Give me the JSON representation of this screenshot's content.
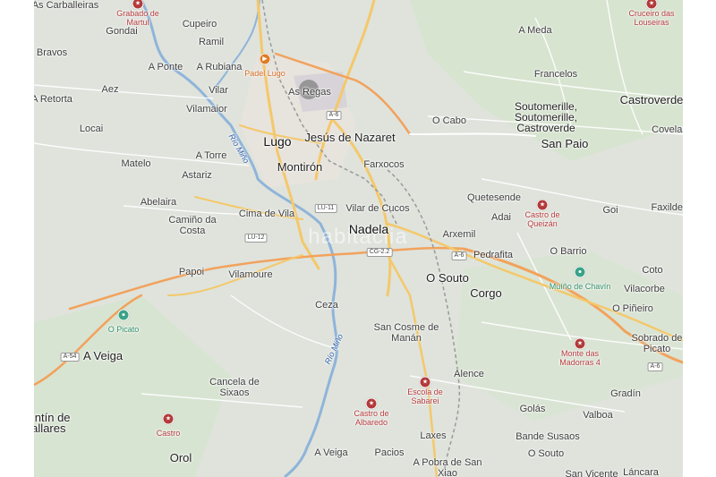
{
  "watermark": "habitaclia",
  "places": [
    {
      "name": "As Carballeiras",
      "cls": ""
    },
    {
      "name": "Gondai",
      "cls": ""
    },
    {
      "name": "Cupeiro",
      "cls": ""
    },
    {
      "name": "Ramil",
      "cls": ""
    },
    {
      "name": "A Meda",
      "cls": ""
    },
    {
      "name": "Bravos",
      "cls": ""
    },
    {
      "name": "A Ponte",
      "cls": ""
    },
    {
      "name": "A Rubiana",
      "cls": ""
    },
    {
      "name": "Francelos",
      "cls": ""
    },
    {
      "name": "Aez",
      "cls": ""
    },
    {
      "name": "Vilar",
      "cls": ""
    },
    {
      "name": "As Regas",
      "cls": ""
    },
    {
      "name": "A Retorta",
      "cls": ""
    },
    {
      "name": "Castroverde",
      "cls": "city"
    },
    {
      "name": "Vilamaior",
      "cls": ""
    },
    {
      "name": "Soutomerille, Soutomerille, Castroverde",
      "cls": "city"
    },
    {
      "name": "O Cabo",
      "cls": ""
    },
    {
      "name": "Locai",
      "cls": ""
    },
    {
      "name": "Lugo",
      "cls": "bigcity"
    },
    {
      "name": "Jesús de Nazaret",
      "cls": "city"
    },
    {
      "name": "Covelas",
      "cls": ""
    },
    {
      "name": "San Paio",
      "cls": "city"
    },
    {
      "name": "A Torre",
      "cls": ""
    },
    {
      "name": "Matelo",
      "cls": ""
    },
    {
      "name": "Montirón",
      "cls": "city"
    },
    {
      "name": "Farxocos",
      "cls": ""
    },
    {
      "name": "Astariz",
      "cls": ""
    },
    {
      "name": "Abelaira",
      "cls": ""
    },
    {
      "name": "Quetesende",
      "cls": ""
    },
    {
      "name": "Faxildes",
      "cls": ""
    },
    {
      "name": "Cima de Vila",
      "cls": ""
    },
    {
      "name": "Vilar de Cucos",
      "cls": ""
    },
    {
      "name": "Goi",
      "cls": ""
    },
    {
      "name": "Camiño da Costa",
      "cls": ""
    },
    {
      "name": "Adai",
      "cls": ""
    },
    {
      "name": "Nadela",
      "cls": "bigcity"
    },
    {
      "name": "Arxemil",
      "cls": ""
    },
    {
      "name": "O Barrio",
      "cls": ""
    },
    {
      "name": "Pedrafita",
      "cls": ""
    },
    {
      "name": "Papoi",
      "cls": ""
    },
    {
      "name": "Coto",
      "cls": ""
    },
    {
      "name": "Vilamoure",
      "cls": ""
    },
    {
      "name": "O Souto",
      "cls": "city"
    },
    {
      "name": "Vilacorbe",
      "cls": ""
    },
    {
      "name": "Corgo",
      "cls": "city"
    },
    {
      "name": "Ceza",
      "cls": ""
    },
    {
      "name": "O Piñeiro",
      "cls": ""
    },
    {
      "name": "San Cosme de Manán",
      "cls": ""
    },
    {
      "name": "Sobrado de Picato",
      "cls": ""
    },
    {
      "name": "A Veiga",
      "cls": "city"
    },
    {
      "name": "Alence",
      "cls": ""
    },
    {
      "name": "Cancela de Sixaos",
      "cls": ""
    },
    {
      "name": "Gradín",
      "cls": ""
    },
    {
      "name": "Golás",
      "cls": ""
    },
    {
      "name": "Valboa",
      "cls": ""
    },
    {
      "name": "Quntín de Pallares",
      "cls": "city"
    },
    {
      "name": "Laxes",
      "cls": ""
    },
    {
      "name": "Bande Susaos",
      "cls": ""
    },
    {
      "name": "Orol",
      "cls": "city"
    },
    {
      "name": "A Veiga",
      "cls": ""
    },
    {
      "name": "Pacios",
      "cls": ""
    },
    {
      "name": "O Souto",
      "cls": ""
    },
    {
      "name": "A Pobra de San Xiao",
      "cls": ""
    },
    {
      "name": "San Vicente",
      "cls": ""
    },
    {
      "name": "Láncara",
      "cls": ""
    }
  ],
  "pois": [
    {
      "name": "Grabado de Martul",
      "color": "red"
    },
    {
      "name": "Cruceiro das Louseiras",
      "color": "red"
    },
    {
      "name": "Padel Lugo",
      "color": "orange"
    },
    {
      "name": "Castro de Queizán",
      "color": "red"
    },
    {
      "name": "Muíño de Chavín",
      "color": "green"
    },
    {
      "name": "O Picato",
      "color": "green"
    },
    {
      "name": "Monte das Madorras 4",
      "color": "red"
    },
    {
      "name": "Castro de Albaredo",
      "color": "red"
    },
    {
      "name": "Escola de Sabarei",
      "color": "red"
    },
    {
      "name": "Castro",
      "color": "red"
    }
  ],
  "rivers": [
    "Río Miño",
    "Río Miño"
  ],
  "shields": [
    "A-6",
    "LU-11",
    "LU-12",
    "CG-2.2",
    "A-6",
    "A-54",
    "A-6"
  ],
  "icons": {
    "orange": "play-icon",
    "red": "star-icon",
    "green": "pin-icon"
  }
}
